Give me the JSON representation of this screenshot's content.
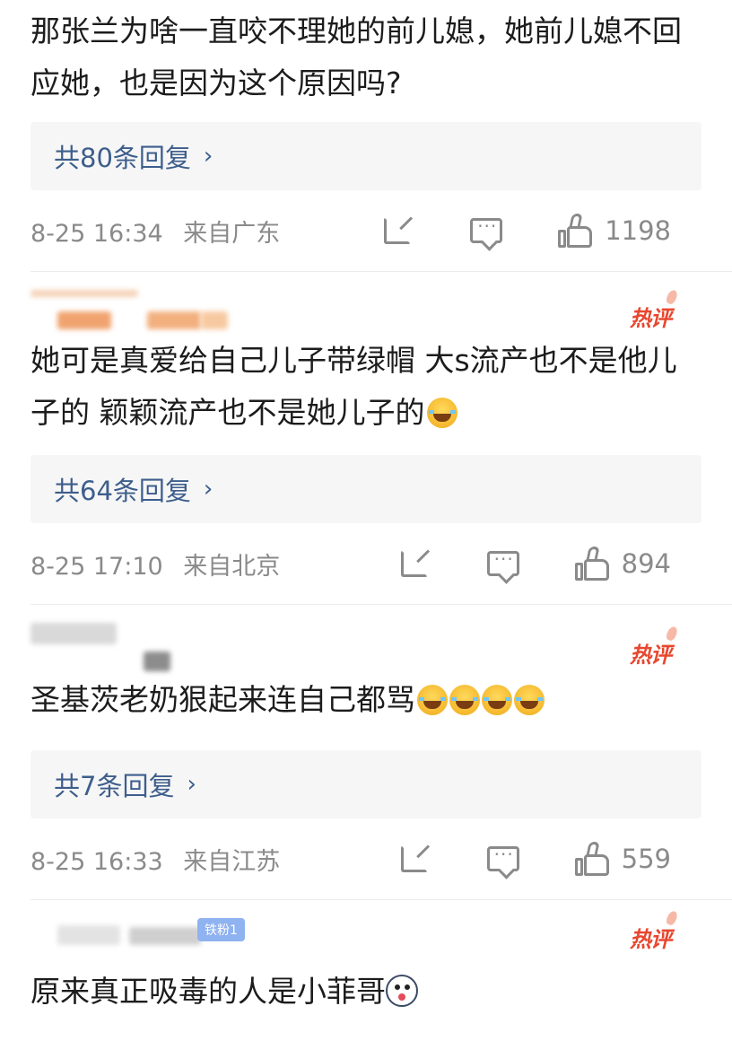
{
  "comments": [
    {
      "text": "那张兰为啥一直咬不理她的前儿媳，她前儿媳不回应她，也是因为这个原因吗?",
      "replies": "共80条回复",
      "date": "8-25 16:34",
      "location": "来自广东",
      "likes": "1198"
    },
    {
      "hot_label": "热评",
      "text": "她可是真爱给自己儿子带绿帽 大s流产也不是他儿子的 颖颖流产也不是她儿子的",
      "emoji": "laugh-cry-emoji",
      "replies": "共64条回复",
      "date": "8-25 17:10",
      "location": "来自北京",
      "likes": "894"
    },
    {
      "hot_label": "热评",
      "text": "圣基茨老奶狠起来连自己都骂",
      "emoji_count": 4,
      "replies": "共7条回复",
      "date": "8-25 16:33",
      "location": "来自江苏",
      "likes": "559"
    },
    {
      "hot_label": "热评",
      "fan_badge": "铁粉1",
      "text": "原来真正吸毒的人是小菲哥",
      "emoji": "dog-emoji"
    }
  ],
  "chevron": "›"
}
